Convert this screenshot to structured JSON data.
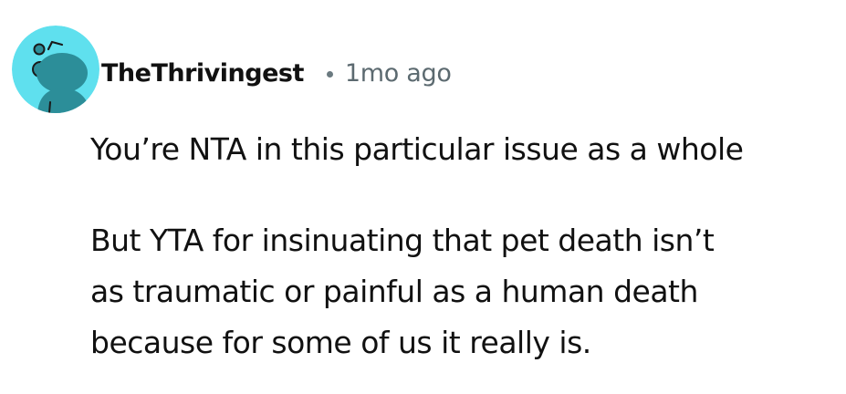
{
  "comment": {
    "author": "TheThrivingest",
    "separator": "•",
    "timestamp": "1mo ago",
    "avatar_icon": "snoo-avatar-icon",
    "avatar_bg": "#5fe0ee",
    "paragraph_1": "You’re NTA in this particular issue as a whole",
    "paragraph_2_lines": [
      "But YTA for insinuating that pet death isn’t",
      "as traumatic or painful as a human death",
      "because for some of us it really is."
    ]
  }
}
